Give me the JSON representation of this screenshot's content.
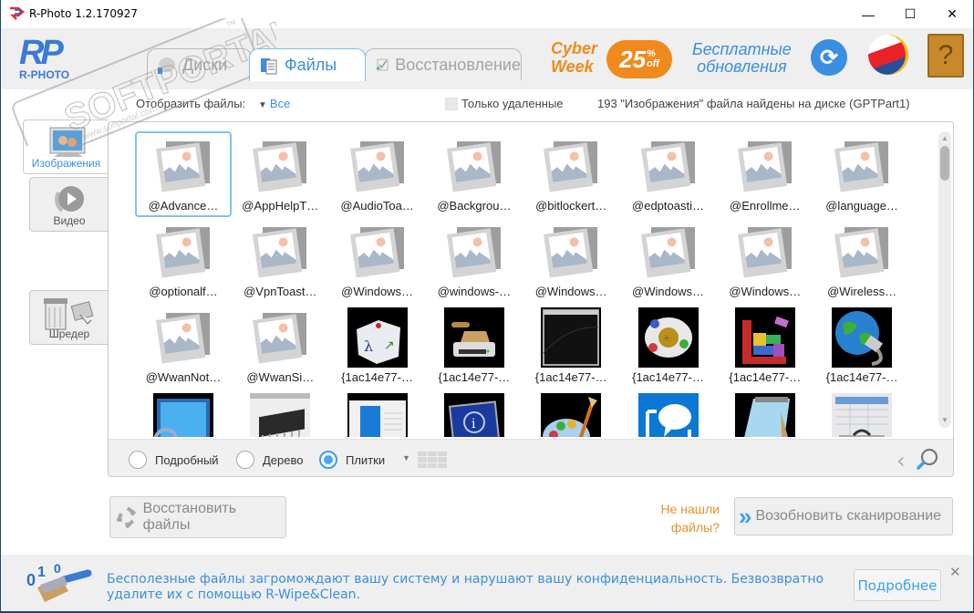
{
  "window": {
    "title": "R-Photo 1.2.170927",
    "controls": {
      "minimize": "—",
      "maximize": "☐",
      "close": "✕"
    }
  },
  "header": {
    "logo_mark": "RP",
    "logo_text": "R-PHOTO",
    "tabs": [
      {
        "label": "Диски",
        "icon": "disk-icon",
        "active": false
      },
      {
        "label": "Файлы",
        "icon": "files-icon",
        "active": true
      },
      {
        "label": "Восстановление",
        "icon": "restore-check-icon",
        "active": false
      }
    ],
    "promo": {
      "line1": "Cyber",
      "line2": "Week",
      "percent": "25",
      "percent_sign": "%",
      "off": "off"
    },
    "free_updates": {
      "line1": "Бесплатные",
      "line2": "обновления"
    },
    "icons": {
      "update": "refresh-icon",
      "language": "language-globe-icon",
      "help": "help-book-icon"
    }
  },
  "filter": {
    "label": "Отобразить файлы:",
    "value": "Все",
    "only_deleted_label": "Только удаленные",
    "only_deleted_checked": false,
    "found_text": "193 \"Изображения\" файла найдены на диске (GPTPart1)"
  },
  "sidebar": {
    "items": [
      {
        "label": "Изображения",
        "icon": "photo-frame-icon",
        "active": true
      },
      {
        "label": "Видео",
        "icon": "video-play-icon",
        "active": false
      },
      {
        "label": "Шредер",
        "icon": "shredder-icon",
        "active": false
      }
    ]
  },
  "files": [
    {
      "name": "@Advance…",
      "thumb": "placeholder",
      "selected": true
    },
    {
      "name": "@AppHelpT…",
      "thumb": "placeholder"
    },
    {
      "name": "@AudioToa…",
      "thumb": "placeholder"
    },
    {
      "name": "@Backgrou…",
      "thumb": "placeholder"
    },
    {
      "name": "@bitlockert…",
      "thumb": "placeholder"
    },
    {
      "name": "@edptoasti…",
      "thumb": "placeholder"
    },
    {
      "name": "@Enrollme…",
      "thumb": "placeholder"
    },
    {
      "name": "@language…",
      "thumb": "placeholder"
    },
    {
      "name": "@optionalf…",
      "thumb": "placeholder"
    },
    {
      "name": "@VpnToast…",
      "thumb": "placeholder"
    },
    {
      "name": "@Windows…",
      "thumb": "placeholder"
    },
    {
      "name": "@windows-…",
      "thumb": "placeholder"
    },
    {
      "name": "@Windows…",
      "thumb": "placeholder"
    },
    {
      "name": "@Windows…",
      "thumb": "placeholder"
    },
    {
      "name": "@Windows…",
      "thumb": "placeholder"
    },
    {
      "name": "@Wireless…",
      "thumb": "placeholder"
    },
    {
      "name": "@WwanNot…",
      "thumb": "placeholder"
    },
    {
      "name": "@WwanSi…",
      "thumb": "placeholder"
    },
    {
      "name": "{1ac14e77-…",
      "thumb": "keyboard-key"
    },
    {
      "name": "{1ac14e77-…",
      "thumb": "drive-stamp"
    },
    {
      "name": "{1ac14e77-…",
      "thumb": "console-window"
    },
    {
      "name": "{1ac14e77-…",
      "thumb": "gamepad"
    },
    {
      "name": "{1ac14e77-…",
      "thumb": "defrag-blocks"
    },
    {
      "name": "{1ac14e77-…",
      "thumb": "network-globe"
    },
    {
      "name": "",
      "thumb": "magnifier-screen"
    },
    {
      "name": "",
      "thumb": "memory-chip"
    },
    {
      "name": "",
      "thumb": "document-window"
    },
    {
      "name": "",
      "thumb": "info-monitor"
    },
    {
      "name": "",
      "thumb": "paint-palette"
    },
    {
      "name": "",
      "thumb": "speech-bubble"
    },
    {
      "name": "",
      "thumb": "notepad"
    },
    {
      "name": "",
      "thumb": "table-toolbox"
    }
  ],
  "view": {
    "modes": [
      {
        "label": "Подробный",
        "checked": false
      },
      {
        "label": "Дерево",
        "checked": false
      },
      {
        "label": "Плитки",
        "checked": true
      }
    ]
  },
  "actions": {
    "restore_label": "Восстановить файлы",
    "not_found_line1": "Не нашли",
    "not_found_line2": "файлы?",
    "rescan_label": "Возобновить сканирование"
  },
  "banner": {
    "line1": "Бесполезные файлы загромождают вашу систему и нарушают вашу конфиденциальность. Безвозвратно",
    "line2": "удалите их с помощью R-Wipe&Clean.",
    "more_label": "Подробнее",
    "close": "✕"
  },
  "watermark": {
    "text": "SOFTPORTAL",
    "url": "www.softportal.com",
    "tm": "TM"
  },
  "colors": {
    "accent": "#3a8fe0",
    "orange": "#e8922e",
    "selection": "#7cc3f2"
  }
}
